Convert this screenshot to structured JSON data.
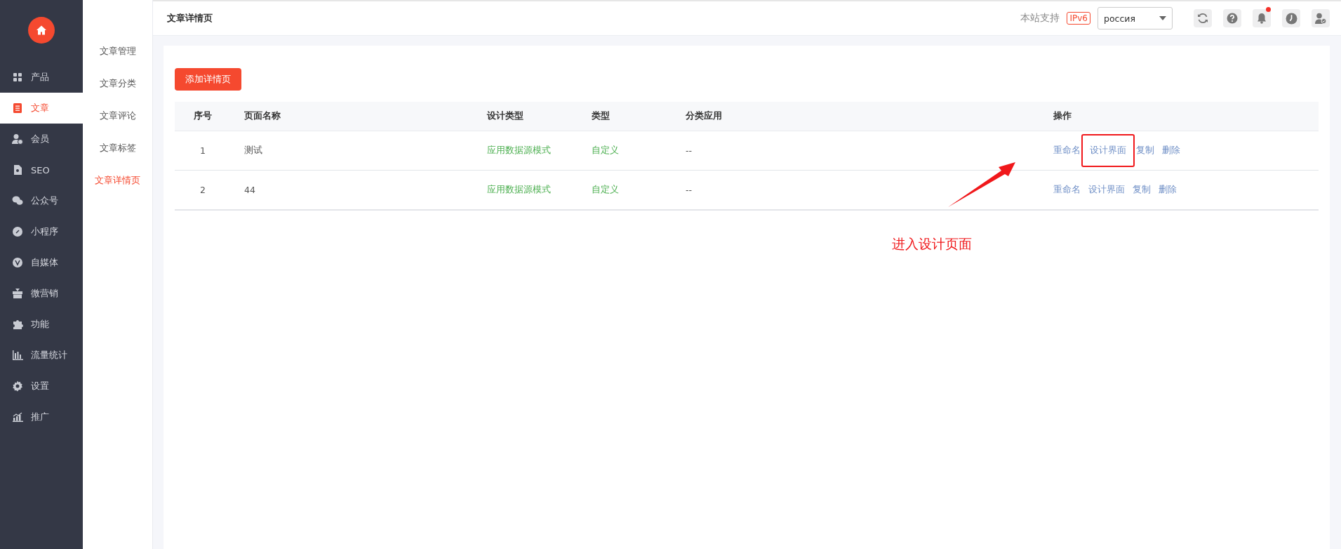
{
  "nav": {
    "items": [
      {
        "label": "产品",
        "selected": false
      },
      {
        "label": "文章",
        "selected": true
      },
      {
        "label": "会员",
        "selected": false
      },
      {
        "label": "SEO",
        "selected": false
      },
      {
        "label": "公众号",
        "selected": false
      },
      {
        "label": "小程序",
        "selected": false
      },
      {
        "label": "自媒体",
        "selected": false
      },
      {
        "label": "微营销",
        "selected": false
      },
      {
        "label": "功能",
        "selected": false
      },
      {
        "label": "流量统计",
        "selected": false
      },
      {
        "label": "设置",
        "selected": false
      },
      {
        "label": "推广",
        "selected": false
      }
    ]
  },
  "submenu": {
    "items": [
      {
        "label": "文章管理",
        "selected": false
      },
      {
        "label": "文章分类",
        "selected": false
      },
      {
        "label": "文章评论",
        "selected": false
      },
      {
        "label": "文章标签",
        "selected": false
      },
      {
        "label": "文章详情页",
        "selected": true
      }
    ]
  },
  "header": {
    "title": "文章详情页",
    "support_text": "本站支持",
    "badge": "IPv6",
    "language": "россия",
    "notification_dot": true
  },
  "add_button": "添加详情页",
  "table": {
    "columns": [
      "序号",
      "页面名称",
      "设计类型",
      "类型",
      "分类应用",
      "操作"
    ],
    "rows": [
      {
        "index": "1",
        "name": "测试",
        "design_type": "应用数据源模式",
        "type": "自定义",
        "category": "--",
        "actions": [
          {
            "label": "重命名",
            "highlighted": false
          },
          {
            "label": "设计界面",
            "highlighted": true
          },
          {
            "label": "复制",
            "highlighted": false
          },
          {
            "label": "删除",
            "highlighted": false
          }
        ]
      },
      {
        "index": "2",
        "name": "44",
        "design_type": "应用数据源模式",
        "type": "自定义",
        "category": "--",
        "actions": [
          {
            "label": "重命名",
            "highlighted": false
          },
          {
            "label": "设计界面",
            "highlighted": false
          },
          {
            "label": "复制",
            "highlighted": false
          },
          {
            "label": "删除",
            "highlighted": false
          }
        ]
      }
    ]
  },
  "annotation": {
    "text": "进入设计页面"
  }
}
